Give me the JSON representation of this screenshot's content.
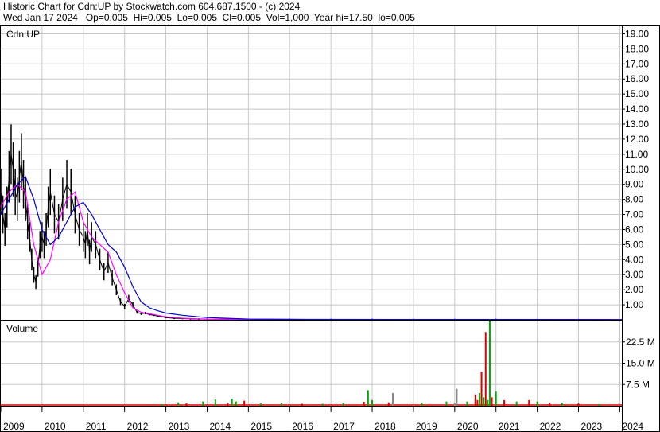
{
  "header": {
    "line1": "Historic Chart for Cdn:UP by Stockwatch.com 604.687.1500 - (c) 2024",
    "line2": "Wed Jan 17 2024   Op=0.005  Hi=0.005  Lo=0.005  Cl=0.005  Vol=1,000  Year hi=17.50  lo=0.005"
  },
  "colors": {
    "price": "#000000",
    "ma_short": "#ff00ff",
    "ma_long": "#0000cc",
    "vol_up": "#00aa00",
    "vol_down": "#dd0000",
    "vol_neutral": "#888888",
    "grid": "#c8c8c8"
  },
  "chart_data": [
    {
      "type": "line",
      "title": "Cdn:UP",
      "y_ticks": [
        "1.00",
        "2.00",
        "3.00",
        "4.00",
        "5.00",
        "6.00",
        "7.00",
        "8.00",
        "9.00",
        "10.00",
        "11.00",
        "12.00",
        "13.00",
        "14.00",
        "15.00",
        "16.00",
        "17.00",
        "18.00",
        "19.00"
      ],
      "ylim": [
        0,
        19.5
      ],
      "x_labels": [
        "2009",
        "2010",
        "2011",
        "2012",
        "2013",
        "2014",
        "2015",
        "2016",
        "2017",
        "2018",
        "2019",
        "2020",
        "2021",
        "2022",
        "2023",
        "2024"
      ],
      "xlim": [
        2009.0,
        2024.05
      ],
      "series": [
        {
          "role": "close",
          "x": [
            2009.0,
            2009.05,
            2009.1,
            2009.15,
            2009.2,
            2009.25,
            2009.3,
            2009.35,
            2009.4,
            2009.45,
            2009.5,
            2009.55,
            2009.6,
            2009.65,
            2009.7,
            2009.75,
            2009.8,
            2009.85,
            2009.9,
            2009.95,
            2010.0,
            2010.05,
            2010.1,
            2010.15,
            2010.2,
            2010.3,
            2010.4,
            2010.5,
            2010.6,
            2010.7,
            2010.8,
            2010.9,
            2011.0,
            2011.05,
            2011.1,
            2011.15,
            2011.2,
            2011.3,
            2011.4,
            2011.5,
            2011.6,
            2011.7,
            2011.8,
            2011.9,
            2012.0,
            2012.1,
            2012.2,
            2012.3,
            2012.4,
            2012.5,
            2012.6,
            2012.7,
            2012.8,
            2012.9,
            2013.0,
            2013.2,
            2013.4,
            2013.6,
            2013.8,
            2014.0,
            2014.5,
            2015.0,
            2016.0,
            2017.0,
            2018.0,
            2019.0,
            2020.0,
            2021.0,
            2022.0,
            2023.0,
            2024.05
          ],
          "y": [
            8.5,
            7.0,
            6.0,
            7.5,
            9.5,
            11.0,
            10.0,
            8.5,
            8.0,
            9.5,
            10.5,
            9.0,
            8.0,
            6.5,
            5.5,
            4.0,
            3.0,
            2.5,
            3.5,
            5.0,
            5.5,
            5.0,
            6.0,
            7.5,
            8.5,
            7.0,
            6.5,
            8.0,
            9.0,
            8.5,
            7.0,
            6.0,
            5.5,
            5.0,
            6.0,
            4.5,
            5.5,
            5.0,
            4.0,
            3.2,
            3.8,
            2.8,
            2.0,
            1.2,
            0.9,
            1.4,
            1.0,
            0.5,
            0.4,
            0.45,
            0.35,
            0.3,
            0.25,
            0.2,
            0.15,
            0.1,
            0.08,
            0.06,
            0.05,
            0.04,
            0.03,
            0.03,
            0.02,
            0.02,
            0.02,
            0.015,
            0.015,
            0.02,
            0.01,
            0.008,
            0.005
          ]
        },
        {
          "role": "moving_average_short",
          "x": [
            2009.0,
            2009.2,
            2009.4,
            2009.6,
            2009.8,
            2010.0,
            2010.2,
            2010.4,
            2010.6,
            2010.8,
            2011.0,
            2011.2,
            2011.4,
            2011.6,
            2011.8,
            2012.0,
            2012.2,
            2012.4,
            2012.6,
            2012.8,
            2013.0,
            2013.4,
            2014.0,
            2015.0,
            2016.0,
            2020.0,
            2024.05
          ],
          "y": [
            7.5,
            8.5,
            9.0,
            8.5,
            5.0,
            3.0,
            4.0,
            6.5,
            8.0,
            8.5,
            6.5,
            5.5,
            5.0,
            4.5,
            3.0,
            1.8,
            0.8,
            0.5,
            0.4,
            0.3,
            0.2,
            0.1,
            0.05,
            0.03,
            0.02,
            0.02,
            0.01
          ]
        },
        {
          "role": "moving_average_long",
          "x": [
            2009.0,
            2009.2,
            2009.4,
            2009.6,
            2009.8,
            2010.0,
            2010.2,
            2010.4,
            2010.6,
            2010.8,
            2011.0,
            2011.2,
            2011.4,
            2011.6,
            2011.8,
            2012.0,
            2012.2,
            2012.4,
            2012.6,
            2012.8,
            2013.0,
            2013.4,
            2014.0,
            2015.0,
            2016.0,
            2020.0,
            2024.05
          ],
          "y": [
            7.0,
            8.0,
            9.0,
            9.5,
            8.0,
            6.0,
            5.0,
            5.5,
            6.5,
            7.5,
            7.8,
            7.0,
            6.0,
            5.0,
            4.5,
            3.5,
            2.2,
            1.2,
            0.8,
            0.6,
            0.45,
            0.3,
            0.15,
            0.05,
            0.03,
            0.02,
            0.01
          ]
        }
      ]
    },
    {
      "type": "bar",
      "title": "Volume",
      "y_ticks": [
        "7.5 M",
        "15.0 M",
        "22.5 M"
      ],
      "ylim": [
        0,
        30
      ],
      "x": [
        2012.9,
        2013.3,
        2013.5,
        2013.9,
        2014.2,
        2014.5,
        2014.6,
        2014.7,
        2014.9,
        2015.3,
        2015.8,
        2016.3,
        2016.8,
        2017.3,
        2017.8,
        2017.9,
        2018.0,
        2018.4,
        2018.5,
        2019.2,
        2019.8,
        2020.0,
        2020.05,
        2020.3,
        2020.5,
        2020.55,
        2020.6,
        2020.65,
        2020.7,
        2020.75,
        2020.8,
        2020.85,
        2020.9,
        2021.0,
        2021.2,
        2021.5,
        2021.8,
        2022.0,
        2022.3,
        2022.6,
        2023.0,
        2023.5
      ],
      "values": [
        0.6,
        1.2,
        0.8,
        1.5,
        2.2,
        1.0,
        2.5,
        1.5,
        1.8,
        0.8,
        0.9,
        0.7,
        0.7,
        0.9,
        1.4,
        5.5,
        2.0,
        1.2,
        4.5,
        1.0,
        1.5,
        0.9,
        6.0,
        1.5,
        4.0,
        2.0,
        4.5,
        12.0,
        3.0,
        26.0,
        2.0,
        30.0,
        3.0,
        5.0,
        2.0,
        1.5,
        2.0,
        1.5,
        1.0,
        1.0,
        0.8,
        0.6
      ],
      "direction": [
        "up",
        "up",
        "down",
        "up",
        "up",
        "down",
        "up",
        "up",
        "down",
        "up",
        "up",
        "down",
        "up",
        "up",
        "down",
        "up",
        "up",
        "down",
        "neutral",
        "up",
        "up",
        "neutral",
        "neutral",
        "up",
        "down",
        "down",
        "up",
        "down",
        "up",
        "down",
        "up",
        "up",
        "down",
        "up",
        "down",
        "up",
        "down",
        "up",
        "down",
        "up",
        "down",
        "up"
      ]
    }
  ]
}
